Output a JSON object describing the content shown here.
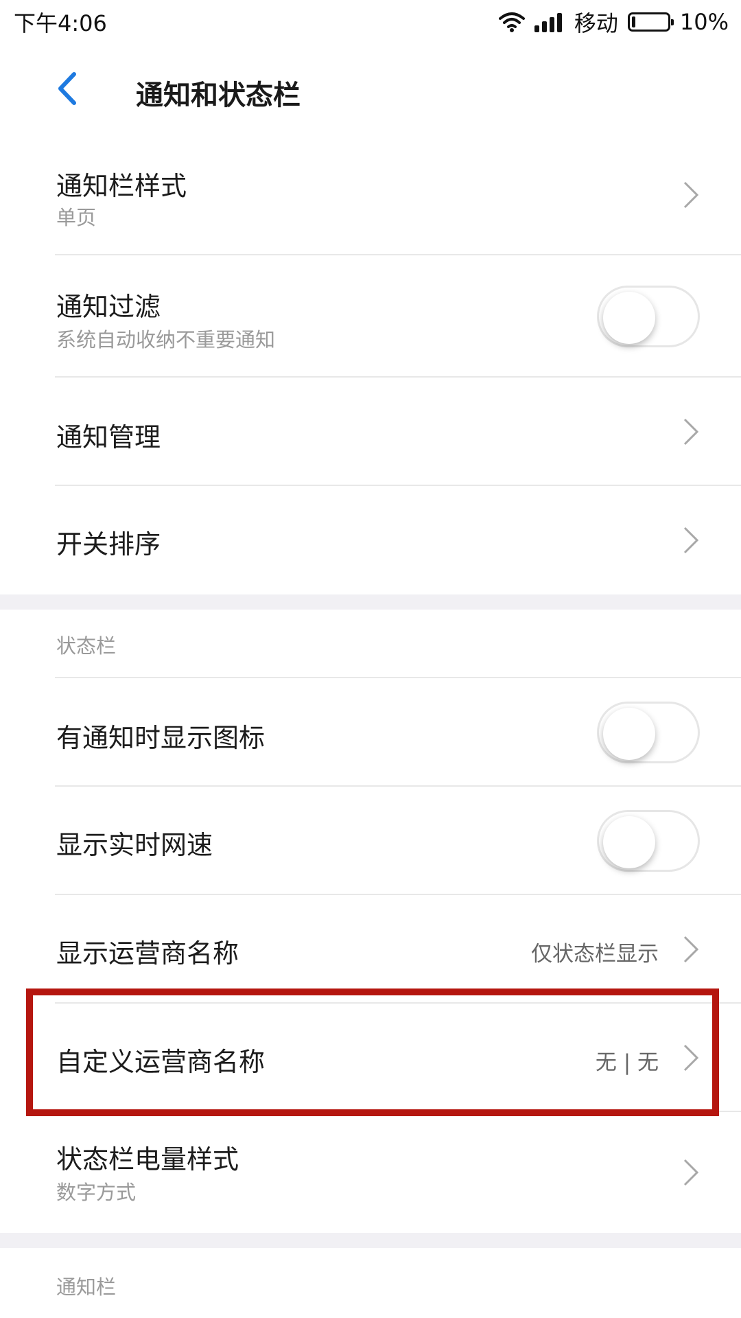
{
  "status_bar": {
    "time": "下午4:06",
    "carrier": "移动",
    "battery": "10%",
    "battery_level": 0.1,
    "icons": [
      "wifi-icon",
      "signal-icon",
      "battery-icon"
    ]
  },
  "header": {
    "title": "通知和状态栏",
    "back_icon": "chevron-left-icon"
  },
  "rows": {
    "notification_style": {
      "title": "通知栏样式",
      "subtitle": "单页"
    },
    "notification_filter": {
      "title": "通知过滤",
      "subtitle": "系统自动收纳不重要通知",
      "toggle_on": false
    },
    "notification_management": {
      "title": "通知管理"
    },
    "switch_order": {
      "title": "开关排序"
    },
    "show_icon_on_notification": {
      "title": "有通知时显示图标",
      "toggle_on": false
    },
    "show_network_speed": {
      "title": "显示实时网速",
      "toggle_on": false
    },
    "show_carrier_name": {
      "title": "显示运营商名称",
      "value": "仅状态栏显示"
    },
    "custom_carrier_name": {
      "title": "自定义运营商名称",
      "value": "无 | 无"
    },
    "battery_style": {
      "title": "状态栏电量样式",
      "subtitle": "数字方式"
    }
  },
  "sections": {
    "status_bar": "状态栏",
    "notification_bar": "通知栏"
  },
  "colors": {
    "accent": "#1e7ae0",
    "highlight": "#b5160f",
    "section_gap": "#f1f0f4"
  }
}
